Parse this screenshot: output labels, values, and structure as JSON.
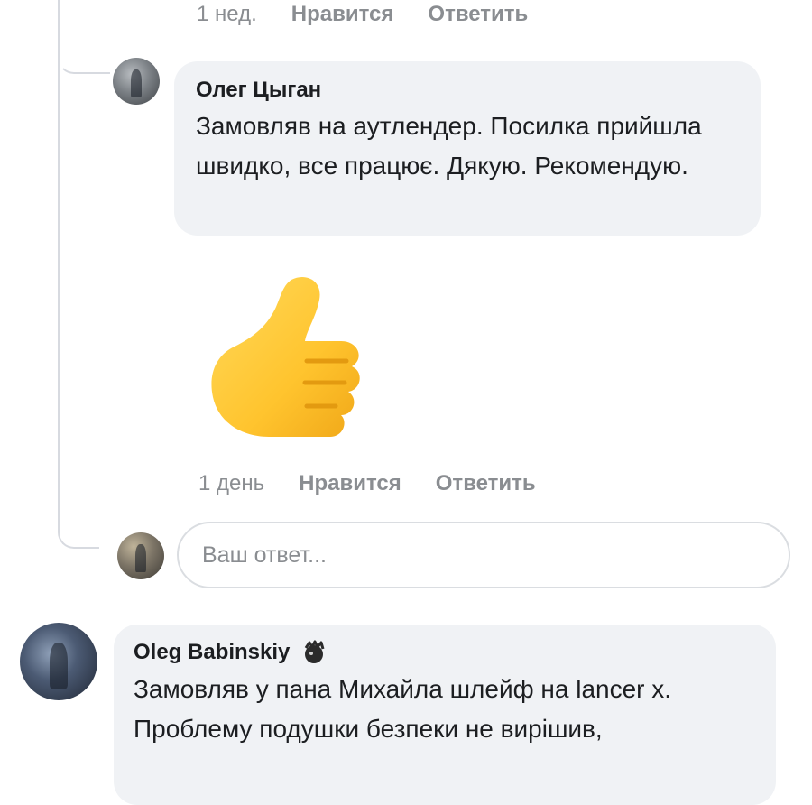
{
  "top_comment": {
    "time": "1 нед.",
    "like_label": "Нравится",
    "reply_label": "Ответить"
  },
  "reply_comment": {
    "author": "Олег Цыган",
    "text": "Замовляв на аутлендер. Посилка прийшла швидко, все працює. Дякую. Рекомендую.",
    "sticker": "thumbs-up-icon",
    "time": "1 день",
    "like_label": "Нравится",
    "reply_label": "Ответить"
  },
  "reply_input": {
    "placeholder": "Ваш ответ..."
  },
  "next_comment": {
    "author": "Oleg Babinskiy",
    "badge": "emoji-badge-icon",
    "text": "Замовляв у пана Михайла шлейф на lancer x. Проблему подушки безпеки не вирішив,"
  },
  "colors": {
    "bubble": "#f0f2f5",
    "meta_text": "#8a8d91",
    "thread_line": "#d7dae0",
    "sticker": "#ffc83d"
  }
}
